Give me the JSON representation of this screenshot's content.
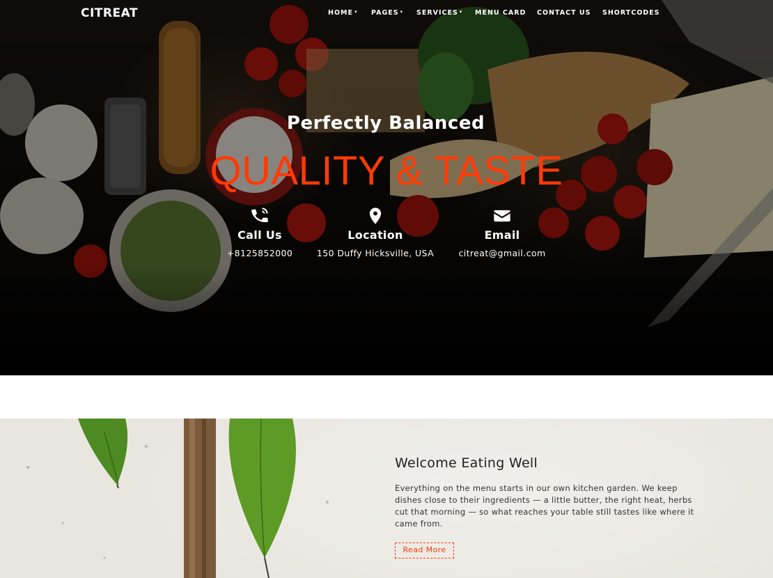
{
  "brand": "CITREAT",
  "nav": [
    {
      "label": "HOME",
      "dropdown": true
    },
    {
      "label": "PAGES",
      "dropdown": true
    },
    {
      "label": "SERVICES",
      "dropdown": true
    },
    {
      "label": "MENU CARD",
      "dropdown": false
    },
    {
      "label": "CONTACT US",
      "dropdown": false
    },
    {
      "label": "SHORTCODES",
      "dropdown": false
    }
  ],
  "hero": {
    "subtitle": "Perfectly Balanced",
    "title": "QUALITY & TASTE",
    "accent_color": "#ff3a06"
  },
  "contacts": [
    {
      "icon": "phone-icon",
      "label": "Call Us",
      "value": "+8125852000"
    },
    {
      "icon": "location-pin-icon",
      "label": "Location",
      "value": "150 Duffy Hicksville, USA"
    },
    {
      "icon": "envelope-icon",
      "label": "Email",
      "value": "citreat@gmail.com"
    }
  ],
  "welcome": {
    "title": "Welcome Eating Well",
    "body": "Everything on the menu starts in our own kitchen garden. We keep dishes close to their ingredients — a little butter, the right heat, herbs cut that morning — so what reaches your table still tastes like where it came from.",
    "button": "Read More"
  }
}
